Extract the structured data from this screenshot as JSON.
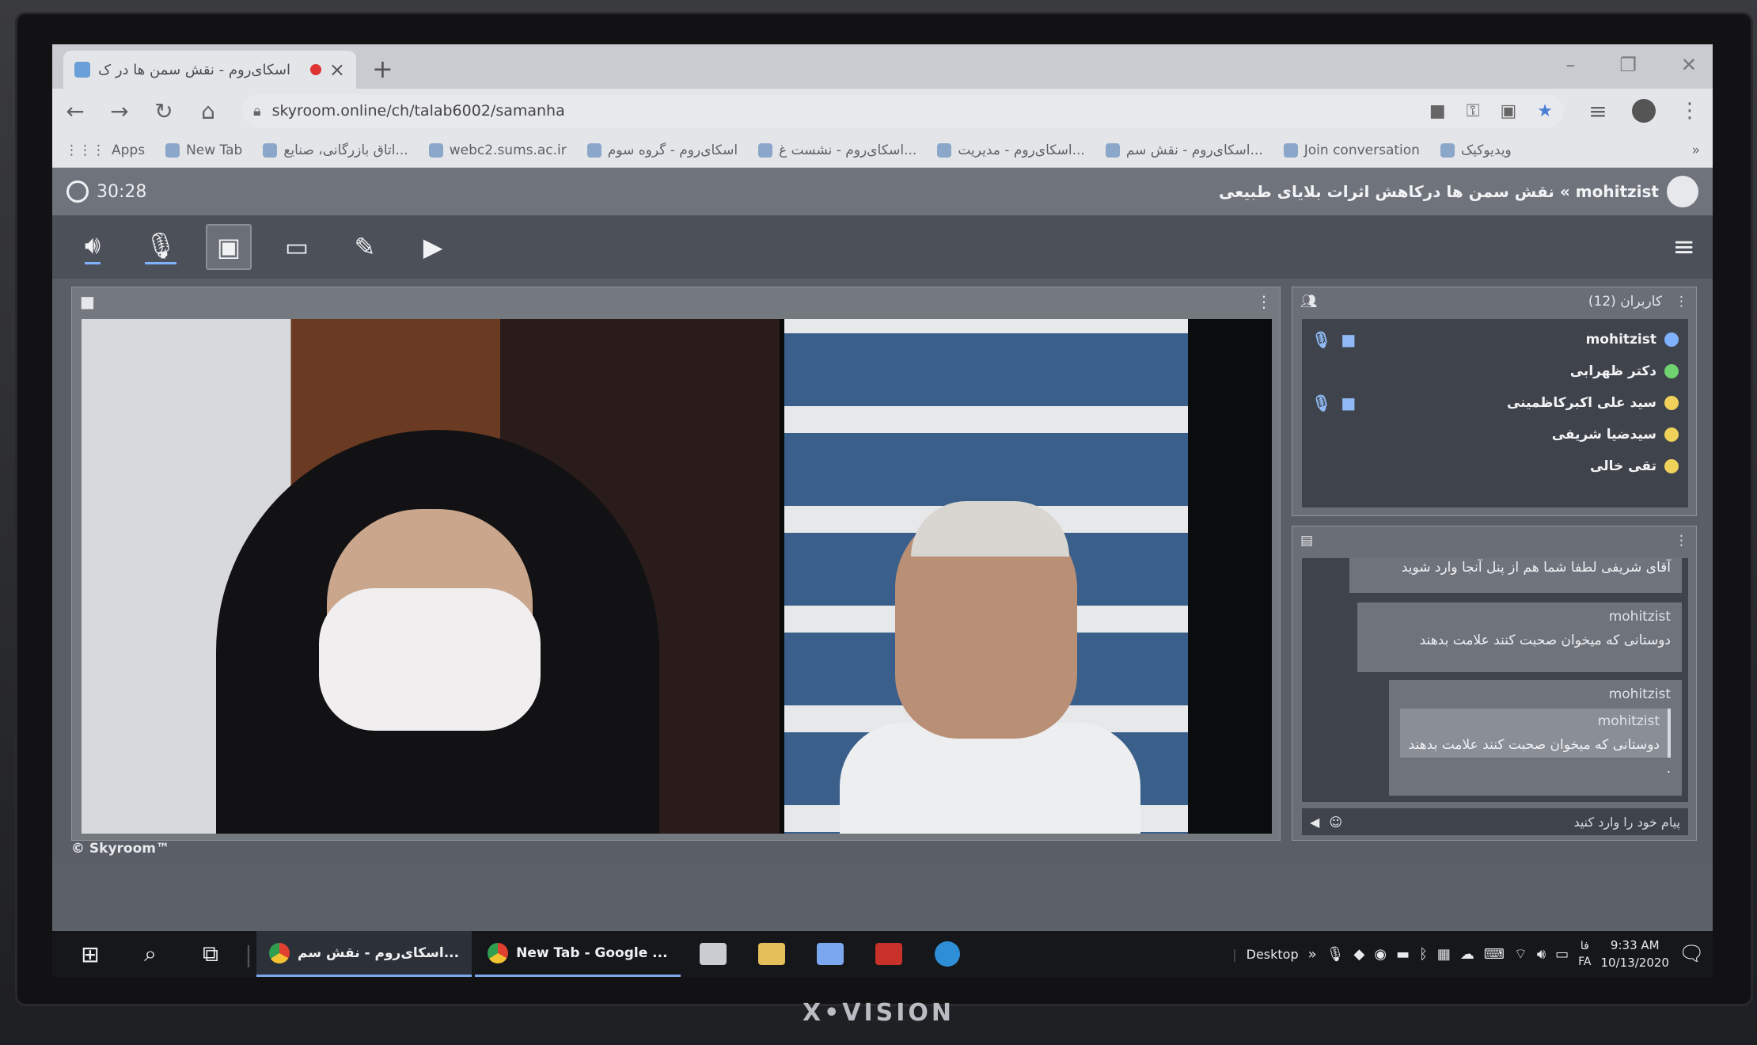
{
  "browser": {
    "tab_title": "اسکای‌روم - نقش سمن ها در ک",
    "new_tab_symbol": "+",
    "url": "skyroom.online/ch/talab6002/samanha",
    "bookmarks": [
      {
        "label": "Apps"
      },
      {
        "label": "New Tab"
      },
      {
        "label": "اتاق بازرگانی، صنایع..."
      },
      {
        "label": "webc2.sums.ac.ir"
      },
      {
        "label": "اسکای‌روم - گروه سوم"
      },
      {
        "label": "اسکای‌روم - نشست غ..."
      },
      {
        "label": "اسکای‌روم - مدیریت..."
      },
      {
        "label": "اسکای‌روم - نقش سم..."
      },
      {
        "label": "Join conversation"
      },
      {
        "label": "ویدیوکیک"
      }
    ]
  },
  "app": {
    "timer": "30:28",
    "room_title": "mohitzist » نقش سمن ها درکاهش اثرات بلایای طبیعی",
    "users_title": "کاربران (12)",
    "users": [
      {
        "name": "mohitzist",
        "mic": true,
        "cam": true,
        "color": "#7fb1ff"
      },
      {
        "name": "دکتر ظهرابی",
        "mic": false,
        "cam": false,
        "color": "#6fd36f"
      },
      {
        "name": "سید علی اکبرکاظمینی",
        "mic": true,
        "cam": true,
        "color": "#f0d25a"
      },
      {
        "name": "سیدضیا شریفی",
        "mic": false,
        "cam": false,
        "color": "#f0d25a"
      },
      {
        "name": "تقی خالی",
        "mic": false,
        "cam": false,
        "color": "#f0d25a"
      }
    ],
    "chat": {
      "partial_message": "آقای شریفی لطفا شما هم از پنل آنجا وارد شوید",
      "messages": [
        {
          "author": "mohitzist",
          "text": "دوستانی که میخوان صحبت کنند علامت بدهند"
        },
        {
          "author": "mohitzist",
          "quote_author": "mohitzist",
          "quote_text": "دوستانی که میخوان صحبت کنند علامت بدهند",
          "text": "."
        }
      ],
      "input_placeholder": "پیام خود را وارد کنید"
    },
    "copyright": "© Skyroom™"
  },
  "taskbar": {
    "tasks": [
      {
        "label": "اسکای‌روم - نقش سم..."
      },
      {
        "label": "New Tab - Google ..."
      }
    ],
    "desktop_label": "Desktop",
    "lang_top": "فا",
    "lang_bottom": "FA",
    "time": "9:33 AM",
    "date": "10/13/2020"
  },
  "monitor_brand": "X•VISION",
  "colors": {
    "accent_blue": "#7fb1ff",
    "panel_bg": "#6a6e76",
    "panel_dark": "#3f434b",
    "toolbar_bg": "#4c5058"
  }
}
